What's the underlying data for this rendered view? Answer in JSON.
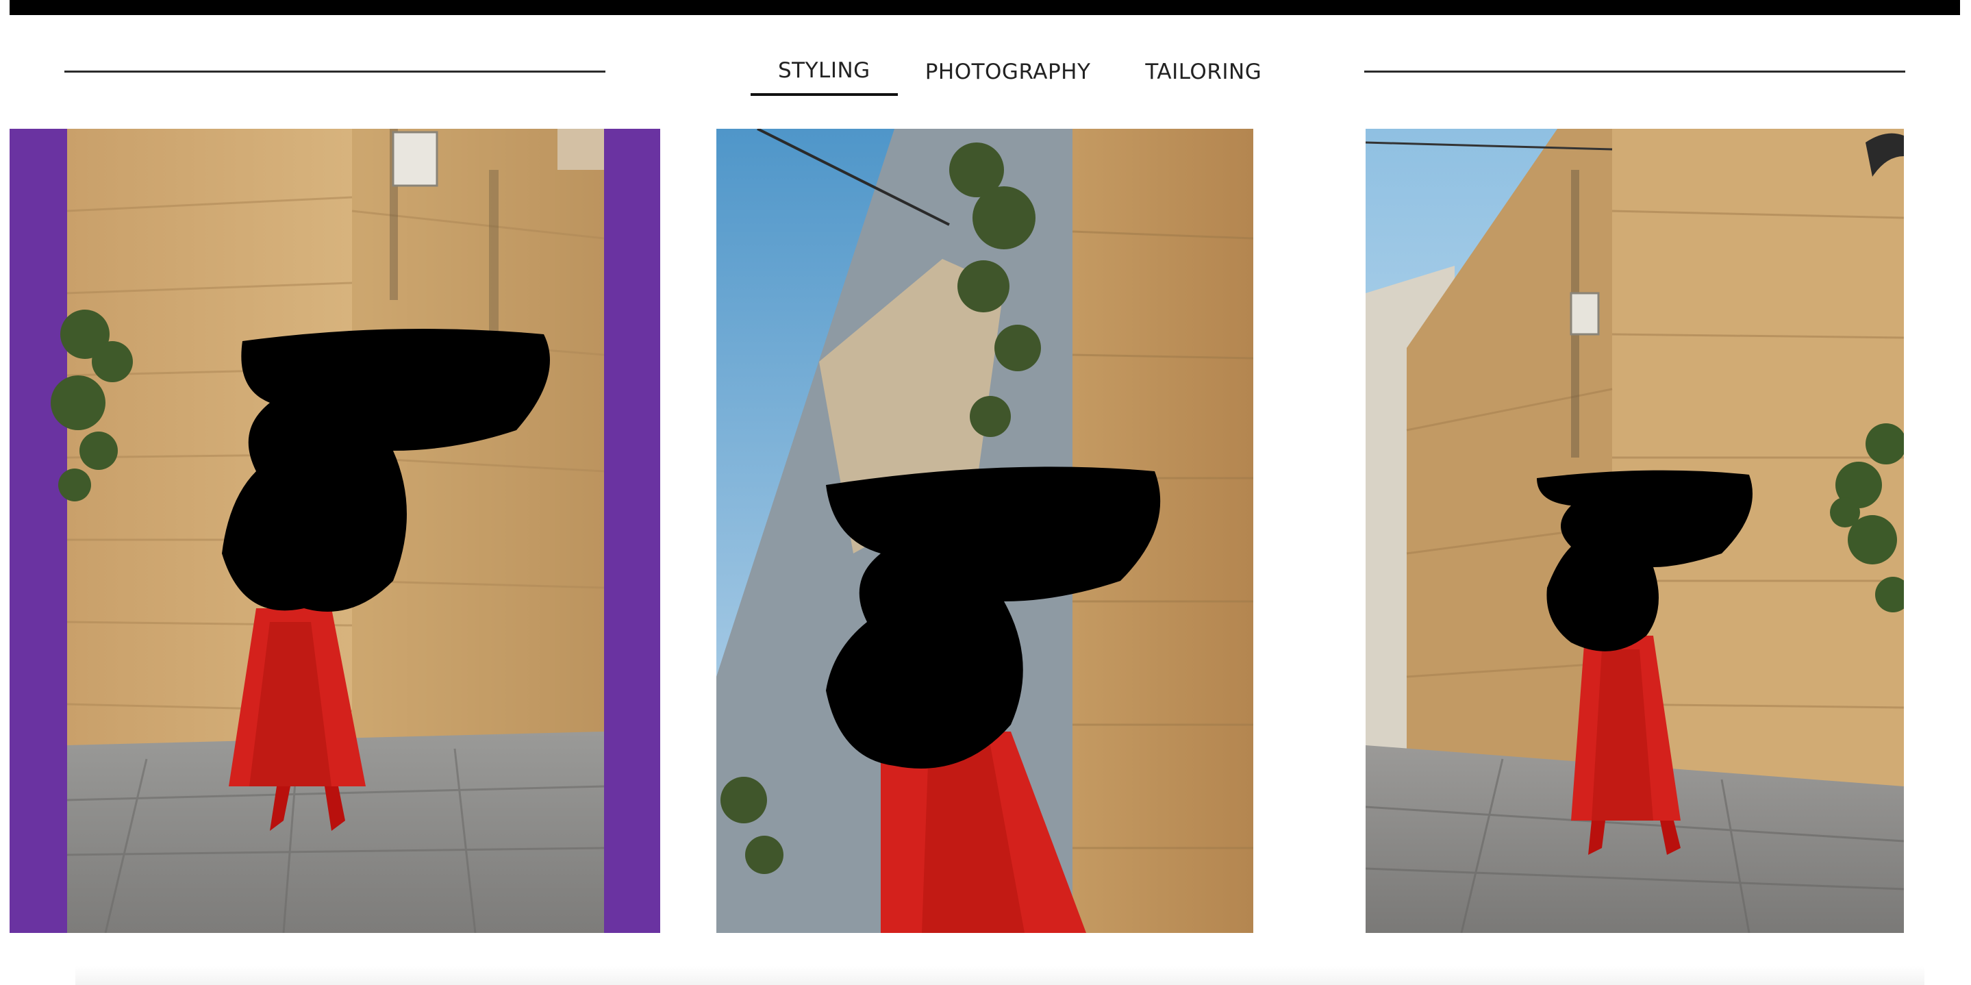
{
  "nav": {
    "tabs": [
      {
        "label": "STYLING",
        "active": true
      },
      {
        "label": "PHOTOGRAPHY",
        "active": false
      },
      {
        "label": "TAILORING",
        "active": false
      }
    ]
  },
  "colors": {
    "accent_purple": "#6a33a1",
    "dress_red": "#d4211c",
    "wall_sand": "#d2ab73",
    "sky_blue": "#74b2dc"
  },
  "gallery": {
    "photos": [
      {
        "subject": "woman in red dress beside stone wall corner",
        "frame": "purple side bands"
      },
      {
        "subject": "woman in red dress under balcony with ivy",
        "frame": "none"
      },
      {
        "subject": "woman in red dress at street corner",
        "frame": "none"
      }
    ]
  }
}
